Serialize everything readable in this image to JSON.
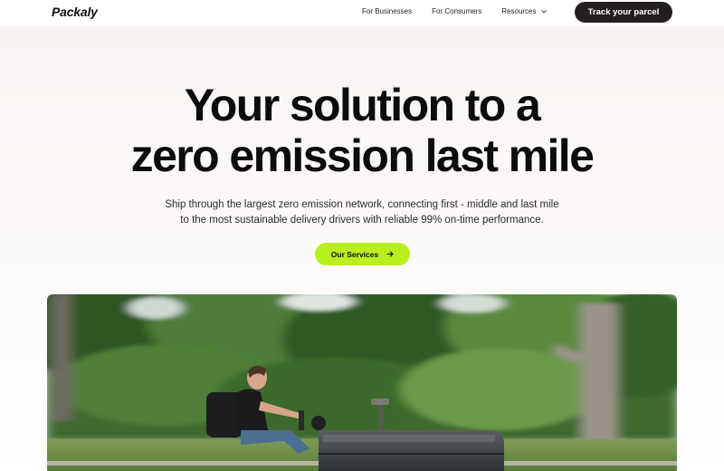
{
  "brand": {
    "logo_text": "Packaly"
  },
  "nav": {
    "items": [
      {
        "label": "For Businesses"
      },
      {
        "label": "For Consumers"
      },
      {
        "label": "Resources",
        "icon": "chevron-down-icon"
      }
    ],
    "track_button_label": "Track your parcel"
  },
  "hero": {
    "title_line1": "Your solution to a",
    "title_line2": "zero emission last mile",
    "subtitle_line1": "Ship through the largest zero emission network, connecting first - middle and last mile",
    "subtitle_line2": "to the most sustainable delivery drivers with reliable 99% on-time performance.",
    "cta_label": "Our Services",
    "cta_icon": "arrow-right-icon"
  },
  "colors": {
    "accent": "#b9ef1c",
    "dark_button": "#241f1f",
    "text": "#0c0c0c"
  }
}
